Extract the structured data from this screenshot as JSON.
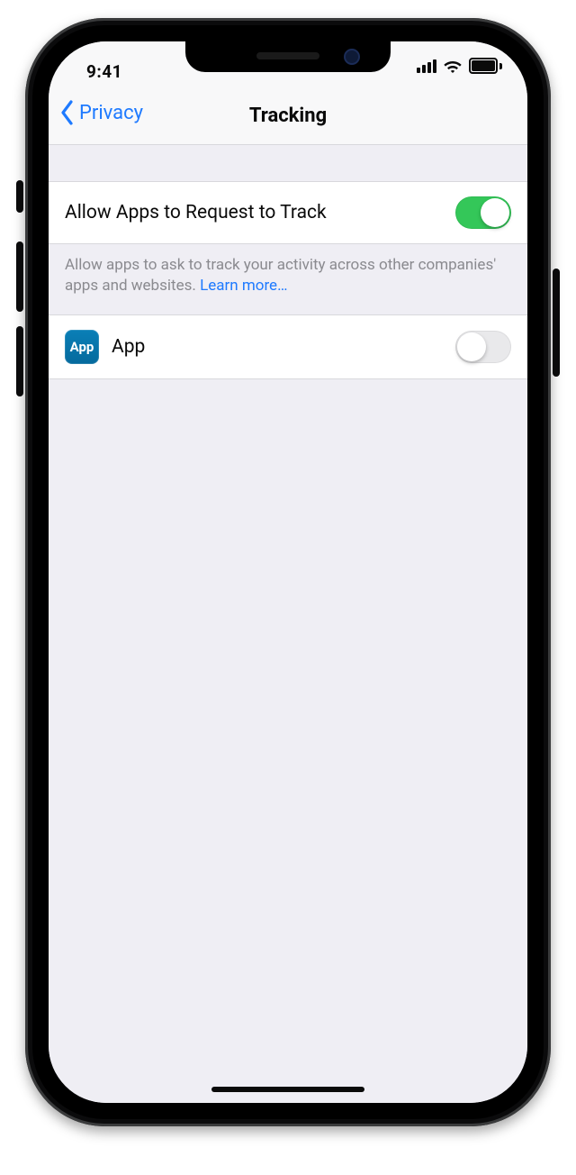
{
  "status": {
    "time": "9:41"
  },
  "nav": {
    "back_label": "Privacy",
    "title": "Tracking"
  },
  "rows": {
    "allow": {
      "label": "Allow Apps to Request to Track",
      "on": true
    },
    "footer": {
      "text": "Allow apps to ask to track your activity across other companies' apps and websites. ",
      "link": "Learn more…"
    },
    "app": {
      "icon_text": "App",
      "label": "App",
      "on": false
    }
  }
}
